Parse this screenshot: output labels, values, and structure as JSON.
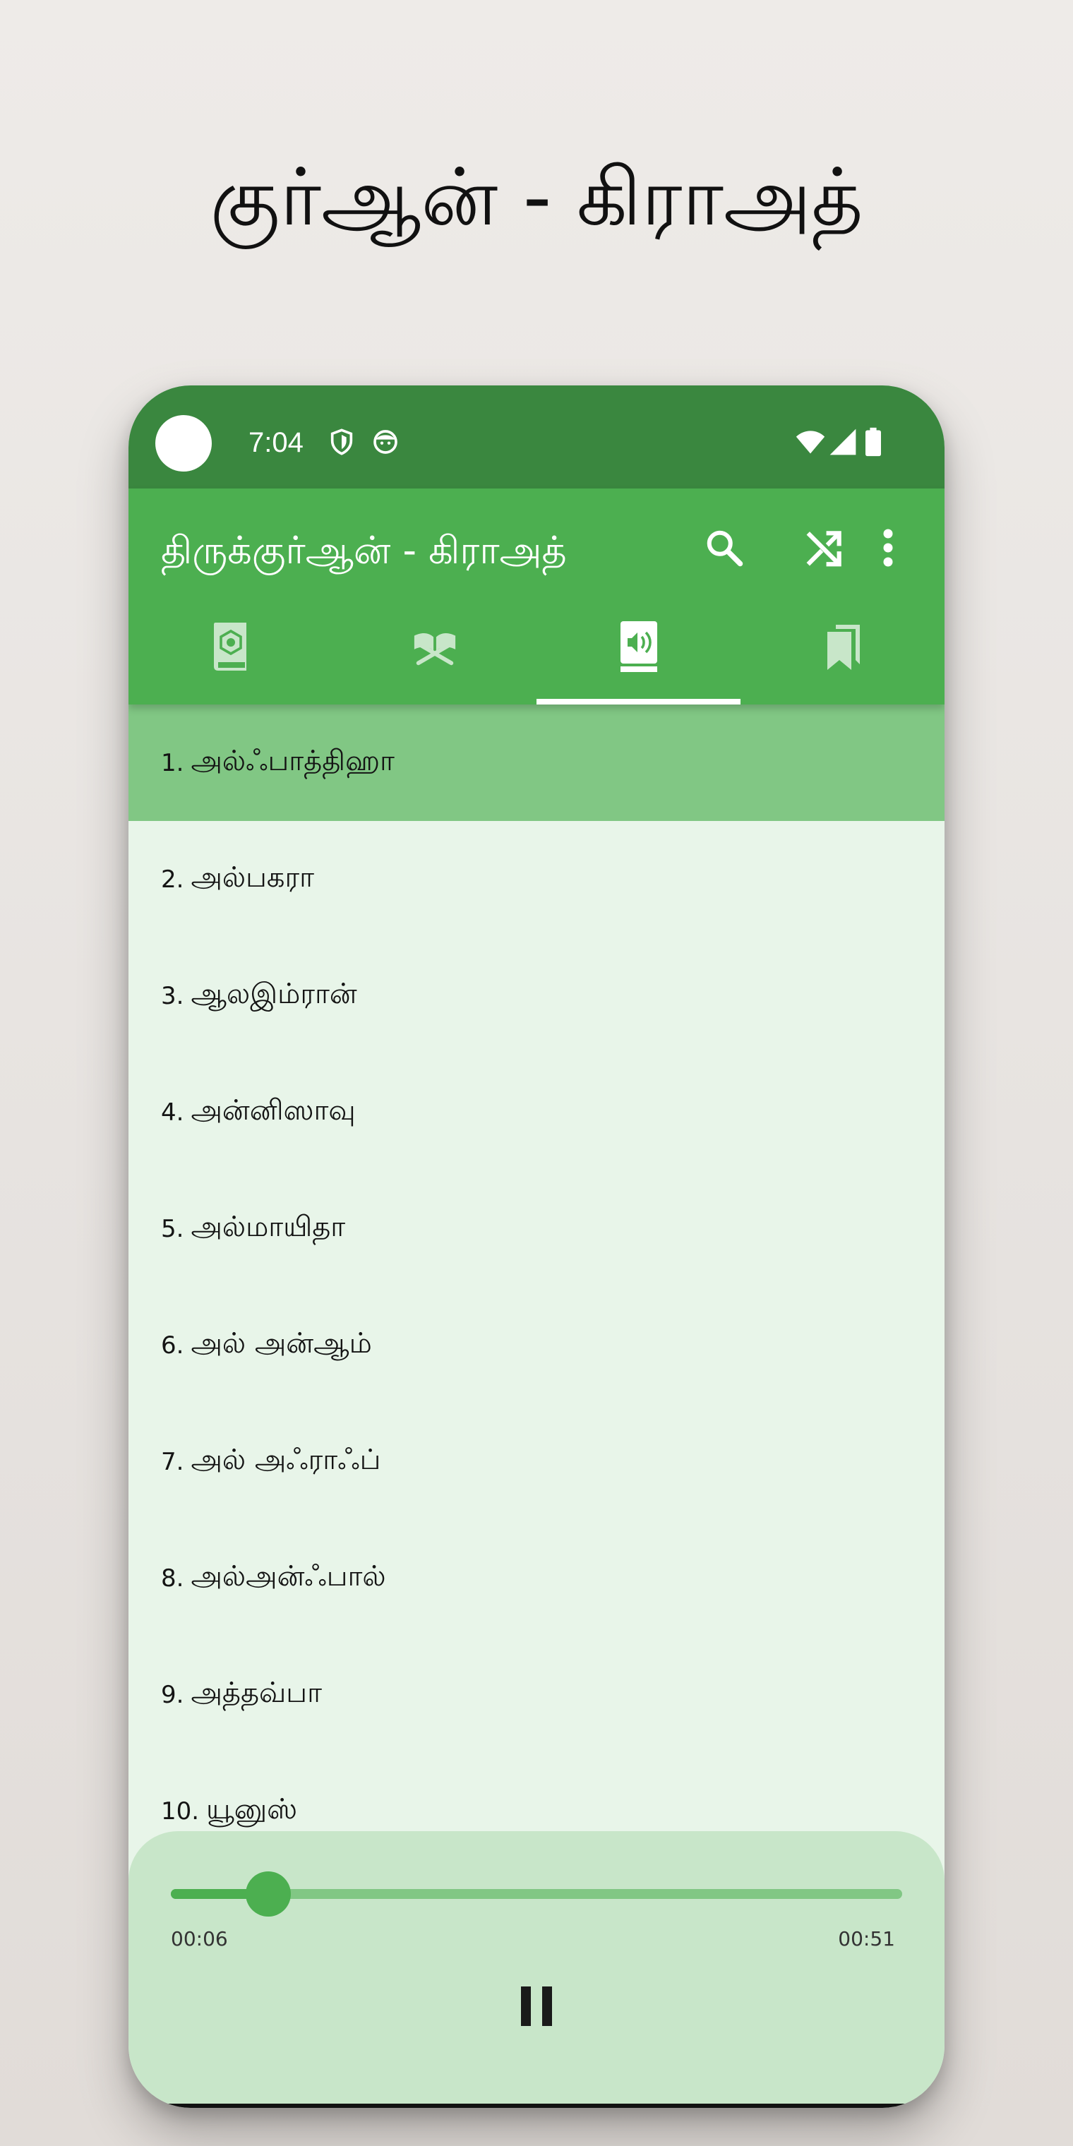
{
  "headline": "குர்ஆன் - கிராஅத்",
  "status_bar": {
    "time": "7:04",
    "icons": [
      "shield-icon",
      "face-icon",
      "wifi-icon",
      "signal-icon",
      "battery-icon"
    ]
  },
  "app_bar": {
    "title": "திருக்குர்ஆன் - கிராஅத்",
    "actions": [
      "search-icon",
      "shuffle-icon",
      "more-vert-icon"
    ],
    "tabs": [
      {
        "icon": "quran-book-icon",
        "selected": false
      },
      {
        "icon": "open-quran-stand-icon",
        "selected": false
      },
      {
        "icon": "audio-book-icon",
        "selected": true
      },
      {
        "icon": "bookmarks-icon",
        "selected": false
      }
    ]
  },
  "surah_list": [
    {
      "num": "1.",
      "name": "அல்ஃபாத்திஹா",
      "selected": true
    },
    {
      "num": "2.",
      "name": "அல்பகரா",
      "selected": false
    },
    {
      "num": "3.",
      "name": "ஆலஇம்ரான்",
      "selected": false
    },
    {
      "num": "4.",
      "name": "அன்னிஸாவு",
      "selected": false
    },
    {
      "num": "5.",
      "name": "அல்மாயிதா",
      "selected": false
    },
    {
      "num": "6.",
      "name": "அல் அன்ஆம்",
      "selected": false
    },
    {
      "num": "7.",
      "name": "அல் அஃராஃப்",
      "selected": false
    },
    {
      "num": "8.",
      "name": "அல்அன்ஃபால்",
      "selected": false
    },
    {
      "num": "9.",
      "name": "அத்தவ்பா",
      "selected": false
    },
    {
      "num": "10.",
      "name": "யூனுஸ்",
      "selected": false
    }
  ],
  "player": {
    "elapsed": "00:06",
    "duration": "00:51",
    "progress": 0.133,
    "control_icon": "pause-icon"
  },
  "colors": {
    "status_bar": "#3a873f",
    "app_bar": "#4caf50",
    "selected_row": "#81c784",
    "list_bg": "#e8f5e9",
    "player_bg": "#c8e6c9"
  }
}
